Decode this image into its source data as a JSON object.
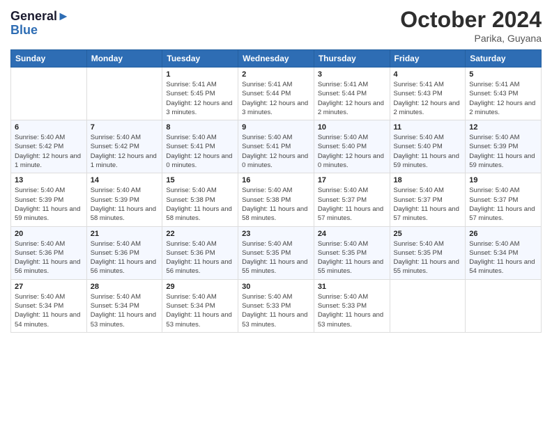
{
  "header": {
    "logo_line1": "General",
    "logo_line2": "Blue",
    "month": "October 2024",
    "location": "Parika, Guyana"
  },
  "days_of_week": [
    "Sunday",
    "Monday",
    "Tuesday",
    "Wednesday",
    "Thursday",
    "Friday",
    "Saturday"
  ],
  "weeks": [
    [
      {
        "day": "",
        "info": ""
      },
      {
        "day": "",
        "info": ""
      },
      {
        "day": "1",
        "info": "Sunrise: 5:41 AM\nSunset: 5:45 PM\nDaylight: 12 hours and 3 minutes."
      },
      {
        "day": "2",
        "info": "Sunrise: 5:41 AM\nSunset: 5:44 PM\nDaylight: 12 hours and 3 minutes."
      },
      {
        "day": "3",
        "info": "Sunrise: 5:41 AM\nSunset: 5:44 PM\nDaylight: 12 hours and 2 minutes."
      },
      {
        "day": "4",
        "info": "Sunrise: 5:41 AM\nSunset: 5:43 PM\nDaylight: 12 hours and 2 minutes."
      },
      {
        "day": "5",
        "info": "Sunrise: 5:41 AM\nSunset: 5:43 PM\nDaylight: 12 hours and 2 minutes."
      }
    ],
    [
      {
        "day": "6",
        "info": "Sunrise: 5:40 AM\nSunset: 5:42 PM\nDaylight: 12 hours and 1 minute."
      },
      {
        "day": "7",
        "info": "Sunrise: 5:40 AM\nSunset: 5:42 PM\nDaylight: 12 hours and 1 minute."
      },
      {
        "day": "8",
        "info": "Sunrise: 5:40 AM\nSunset: 5:41 PM\nDaylight: 12 hours and 0 minutes."
      },
      {
        "day": "9",
        "info": "Sunrise: 5:40 AM\nSunset: 5:41 PM\nDaylight: 12 hours and 0 minutes."
      },
      {
        "day": "10",
        "info": "Sunrise: 5:40 AM\nSunset: 5:40 PM\nDaylight: 12 hours and 0 minutes."
      },
      {
        "day": "11",
        "info": "Sunrise: 5:40 AM\nSunset: 5:40 PM\nDaylight: 11 hours and 59 minutes."
      },
      {
        "day": "12",
        "info": "Sunrise: 5:40 AM\nSunset: 5:39 PM\nDaylight: 11 hours and 59 minutes."
      }
    ],
    [
      {
        "day": "13",
        "info": "Sunrise: 5:40 AM\nSunset: 5:39 PM\nDaylight: 11 hours and 59 minutes."
      },
      {
        "day": "14",
        "info": "Sunrise: 5:40 AM\nSunset: 5:39 PM\nDaylight: 11 hours and 58 minutes."
      },
      {
        "day": "15",
        "info": "Sunrise: 5:40 AM\nSunset: 5:38 PM\nDaylight: 11 hours and 58 minutes."
      },
      {
        "day": "16",
        "info": "Sunrise: 5:40 AM\nSunset: 5:38 PM\nDaylight: 11 hours and 58 minutes."
      },
      {
        "day": "17",
        "info": "Sunrise: 5:40 AM\nSunset: 5:37 PM\nDaylight: 11 hours and 57 minutes."
      },
      {
        "day": "18",
        "info": "Sunrise: 5:40 AM\nSunset: 5:37 PM\nDaylight: 11 hours and 57 minutes."
      },
      {
        "day": "19",
        "info": "Sunrise: 5:40 AM\nSunset: 5:37 PM\nDaylight: 11 hours and 57 minutes."
      }
    ],
    [
      {
        "day": "20",
        "info": "Sunrise: 5:40 AM\nSunset: 5:36 PM\nDaylight: 11 hours and 56 minutes."
      },
      {
        "day": "21",
        "info": "Sunrise: 5:40 AM\nSunset: 5:36 PM\nDaylight: 11 hours and 56 minutes."
      },
      {
        "day": "22",
        "info": "Sunrise: 5:40 AM\nSunset: 5:36 PM\nDaylight: 11 hours and 56 minutes."
      },
      {
        "day": "23",
        "info": "Sunrise: 5:40 AM\nSunset: 5:35 PM\nDaylight: 11 hours and 55 minutes."
      },
      {
        "day": "24",
        "info": "Sunrise: 5:40 AM\nSunset: 5:35 PM\nDaylight: 11 hours and 55 minutes."
      },
      {
        "day": "25",
        "info": "Sunrise: 5:40 AM\nSunset: 5:35 PM\nDaylight: 11 hours and 55 minutes."
      },
      {
        "day": "26",
        "info": "Sunrise: 5:40 AM\nSunset: 5:34 PM\nDaylight: 11 hours and 54 minutes."
      }
    ],
    [
      {
        "day": "27",
        "info": "Sunrise: 5:40 AM\nSunset: 5:34 PM\nDaylight: 11 hours and 54 minutes."
      },
      {
        "day": "28",
        "info": "Sunrise: 5:40 AM\nSunset: 5:34 PM\nDaylight: 11 hours and 53 minutes."
      },
      {
        "day": "29",
        "info": "Sunrise: 5:40 AM\nSunset: 5:34 PM\nDaylight: 11 hours and 53 minutes."
      },
      {
        "day": "30",
        "info": "Sunrise: 5:40 AM\nSunset: 5:33 PM\nDaylight: 11 hours and 53 minutes."
      },
      {
        "day": "31",
        "info": "Sunrise: 5:40 AM\nSunset: 5:33 PM\nDaylight: 11 hours and 53 minutes."
      },
      {
        "day": "",
        "info": ""
      },
      {
        "day": "",
        "info": ""
      }
    ]
  ]
}
